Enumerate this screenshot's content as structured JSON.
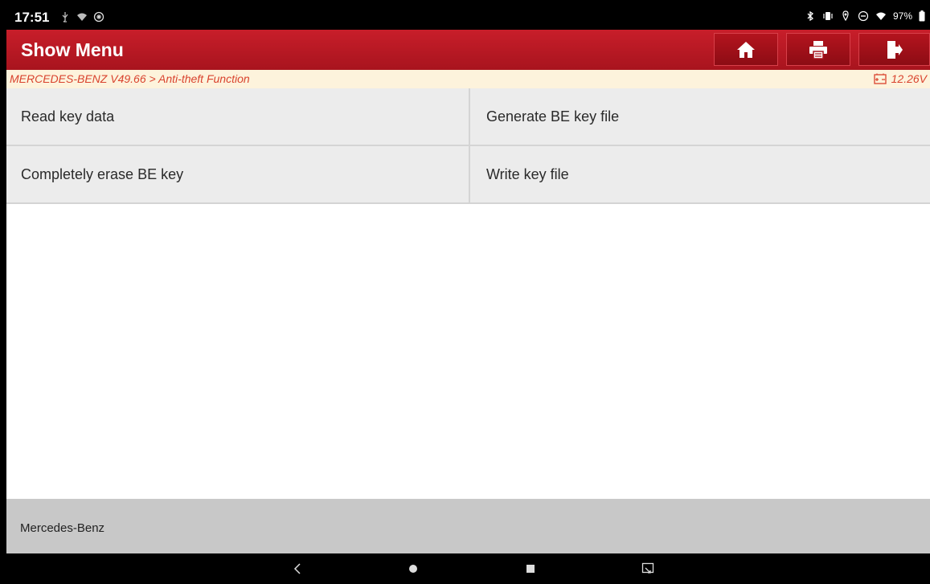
{
  "status_bar": {
    "time": "17:51",
    "battery_percent": "97%",
    "left_icons": [
      "usb-icon",
      "wifi-icon",
      "notification-icon"
    ],
    "right_icons": [
      "bluetooth-icon",
      "vibrate-icon",
      "location-icon",
      "dnd-icon",
      "wifi-icon",
      "battery-icon"
    ]
  },
  "header": {
    "title": "Show Menu",
    "buttons": [
      "home-icon",
      "print-icon",
      "exit-icon"
    ]
  },
  "breadcrumb": {
    "path": "MERCEDES-BENZ V49.66 > Anti-theft Function",
    "voltage": "12.26V"
  },
  "menu": {
    "items": [
      {
        "label": "Read key data"
      },
      {
        "label": "Generate BE key file"
      },
      {
        "label": "Completely erase BE key"
      },
      {
        "label": "Write key file"
      }
    ]
  },
  "footer": {
    "label": "Mercedes-Benz"
  },
  "colors": {
    "header_red": "#c81e2a",
    "breadcrumb_text": "#d9432e",
    "breadcrumb_bg": "#fdf3dc",
    "menu_bg": "#ececec",
    "footer_bg": "#c8c8c8"
  }
}
